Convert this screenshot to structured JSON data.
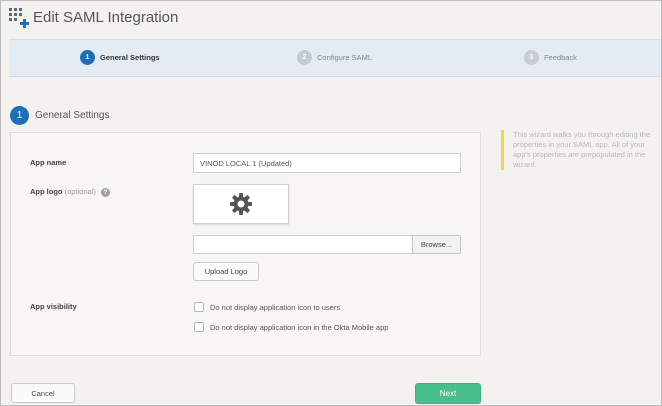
{
  "header": {
    "title": "Edit SAML Integration",
    "icon": "add-app-grid-icon"
  },
  "stepper": {
    "steps": [
      {
        "number": "1",
        "label": "General Settings",
        "state": "active"
      },
      {
        "number": "2",
        "label": "Configure SAML",
        "state": "inactive"
      },
      {
        "number": "3",
        "label": "Feedback",
        "state": "inactive"
      }
    ]
  },
  "section": {
    "number": "1",
    "title": "General Settings"
  },
  "form": {
    "app_name_label": "App name",
    "app_name_value": "VINOD LOCAL 1 (Updated)",
    "app_logo_label": "App logo",
    "app_logo_optional": "(optional)",
    "help_glyph": "?",
    "logo_placeholder_icon": "gear-icon",
    "browse_label": "Browse...",
    "upload_label": "Upload Logo",
    "visibility_label": "App visibility",
    "visibility_options": [
      "Do not display application icon to users",
      "Do not display application icon in the Okta Mobile app"
    ]
  },
  "notice": {
    "text": "This wizard walks you through editing the properties in your SAML app. All of your app's properties are prepopulated in the wizard."
  },
  "footer": {
    "cancel_label": "Cancel",
    "next_label": "Next"
  },
  "colors": {
    "accent": "#1d6fb8",
    "next": "#47bf8c",
    "notice_bar": "#f5d547"
  }
}
